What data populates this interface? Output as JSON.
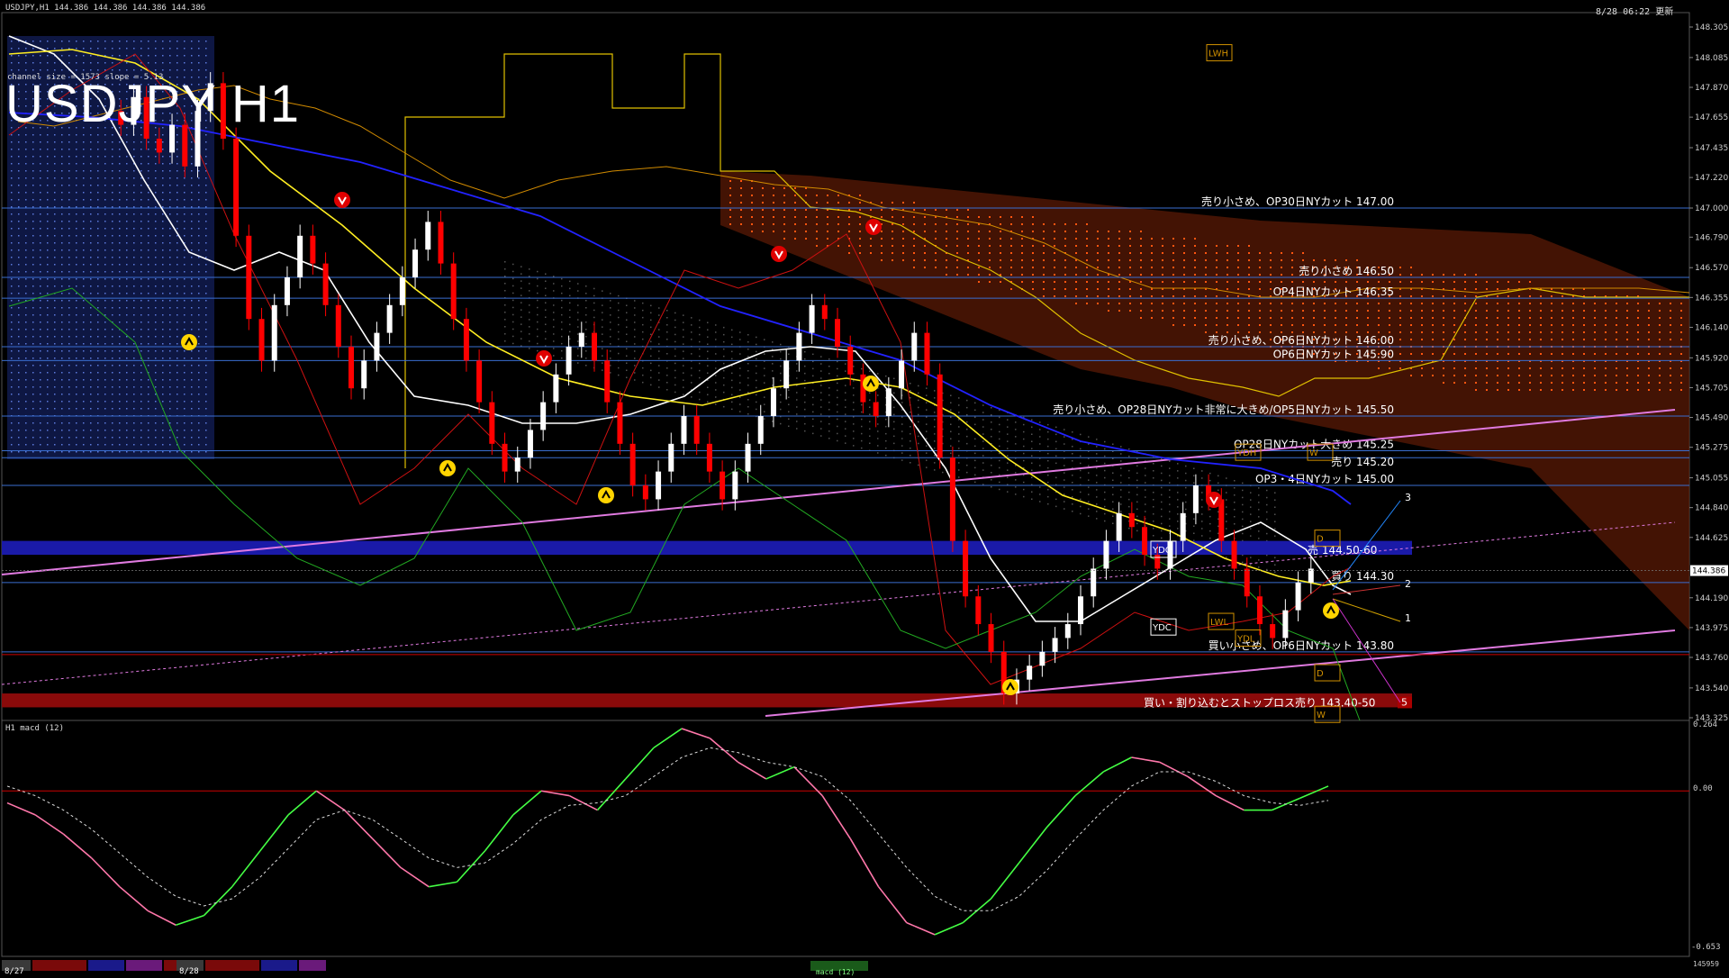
{
  "header": {
    "symbol_info": "USDJPY,H1  144.386 144.386 144.386 144.386",
    "datetime": "8/28 06:22 更新",
    "big_title": "USDJPY H1",
    "channel_info": "channel size = 1573 slope = 5.13"
  },
  "sub_window": {
    "label": "H1  macd (12)",
    "y_top": "0.264",
    "y_zero": "0.00",
    "y_bottom": "-0.653"
  },
  "timeline": {
    "date1": "8/27",
    "date2": "8/28",
    "macd_tab": "macd (12)",
    "bottom_value": "145959"
  },
  "colors": {
    "up_candle": "#ffffff",
    "down_candle": "#ff0000",
    "resistance_line": "#3a6ed0",
    "channel": "#e07ae0",
    "ma_fast": "#ffffff",
    "ma_mid": "#ffee22",
    "ma_slow": "#2222ff",
    "kumo_resistance": "#ff4400",
    "macd_up": "#44ff44",
    "macd_down": "#ff77aa"
  },
  "chart_data": {
    "type": "candlestick",
    "yaxis": {
      "min": 143.325,
      "max": 148.305
    },
    "ylim": [
      143.2,
      148.5
    ],
    "yticks": [
      148.305,
      148.085,
      147.87,
      147.655,
      147.435,
      147.22,
      147.0,
      146.79,
      146.57,
      146.355,
      146.14,
      145.92,
      145.705,
      145.49,
      145.275,
      145.055,
      144.84,
      144.625,
      144.19,
      143.975,
      143.76,
      143.54,
      143.325
    ],
    "current_price": 144.386,
    "current_price_label": "144.386",
    "levels": [
      {
        "price": 147.0,
        "label": "売り小さめ、OP30日NYカット 147.00"
      },
      {
        "price": 146.5,
        "label": "売り小さめ 146.50"
      },
      {
        "price": 146.35,
        "label": "OP4日NYカット 146.35"
      },
      {
        "price": 146.0,
        "label": "売り小さめ、OP6日NYカット 146.00"
      },
      {
        "price": 145.9,
        "label": "OP6日NYカット 145.90"
      },
      {
        "price": 145.5,
        "label": "売り小さめ、OP28日NYカット非常に大きめ/OP5日NYカット 145.50"
      },
      {
        "price": 145.25,
        "label": "OP28日NYカット大きめ 145.25"
      },
      {
        "price": 145.2,
        "label": "売り 145.20"
      },
      {
        "price": 145.0,
        "label": "OP3・4日NYカット 145.00"
      },
      {
        "price": 144.3,
        "label": "買り 144.30"
      },
      {
        "price": 143.8,
        "label": "買い小さめ、OP6日NYカット 143.80"
      }
    ],
    "zones": [
      {
        "from": 144.5,
        "to": 144.6,
        "color": "#1a1aa8",
        "label": "売 144.50-60"
      },
      {
        "from": 143.4,
        "to": 143.5,
        "color": "#8a0a0a",
        "label": "買い・割り込むとストップロス売り 143.40-50"
      }
    ],
    "zone_tag": "5",
    "markers": [
      {
        "label": "LWH",
        "price": 148.1
      },
      {
        "label": "YDH",
        "price": 145.22
      },
      {
        "label": "W",
        "price": 145.22
      },
      {
        "label": "YDO",
        "price": 144.52
      },
      {
        "label": "D",
        "price": 144.6
      },
      {
        "label": "YDC",
        "price": 143.96
      },
      {
        "label": "LWL",
        "price": 144.0
      },
      {
        "label": "YDL",
        "price": 143.88
      },
      {
        "label": "D",
        "price": 143.63
      },
      {
        "label": "W",
        "price": 143.33
      }
    ],
    "projection_labels": [
      "3",
      "2",
      "1"
    ],
    "macd": {
      "ylim": [
        -0.653,
        0.264
      ],
      "main_line": [
        -0.05,
        -0.1,
        -0.18,
        -0.28,
        -0.4,
        -0.5,
        -0.56,
        -0.52,
        -0.4,
        -0.25,
        -0.1,
        0.0,
        -0.08,
        -0.2,
        -0.32,
        -0.4,
        -0.38,
        -0.25,
        -0.1,
        0.0,
        -0.02,
        -0.08,
        0.05,
        0.18,
        0.26,
        0.22,
        0.12,
        0.05,
        0.1,
        -0.02,
        -0.2,
        -0.4,
        -0.55,
        -0.6,
        -0.55,
        -0.45,
        -0.3,
        -0.15,
        -0.02,
        0.08,
        0.14,
        0.12,
        0.06,
        -0.02,
        -0.08,
        -0.08,
        -0.03,
        0.02
      ],
      "signal_line": [
        0.02,
        -0.02,
        -0.08,
        -0.16,
        -0.26,
        -0.36,
        -0.44,
        -0.48,
        -0.45,
        -0.36,
        -0.24,
        -0.12,
        -0.08,
        -0.12,
        -0.2,
        -0.28,
        -0.32,
        -0.3,
        -0.22,
        -0.12,
        -0.06,
        -0.05,
        -0.02,
        0.06,
        0.14,
        0.18,
        0.16,
        0.12,
        0.1,
        0.06,
        -0.04,
        -0.18,
        -0.32,
        -0.44,
        -0.5,
        -0.5,
        -0.44,
        -0.33,
        -0.2,
        -0.08,
        0.02,
        0.08,
        0.08,
        0.04,
        -0.02,
        -0.05,
        -0.06,
        -0.04
      ]
    }
  }
}
